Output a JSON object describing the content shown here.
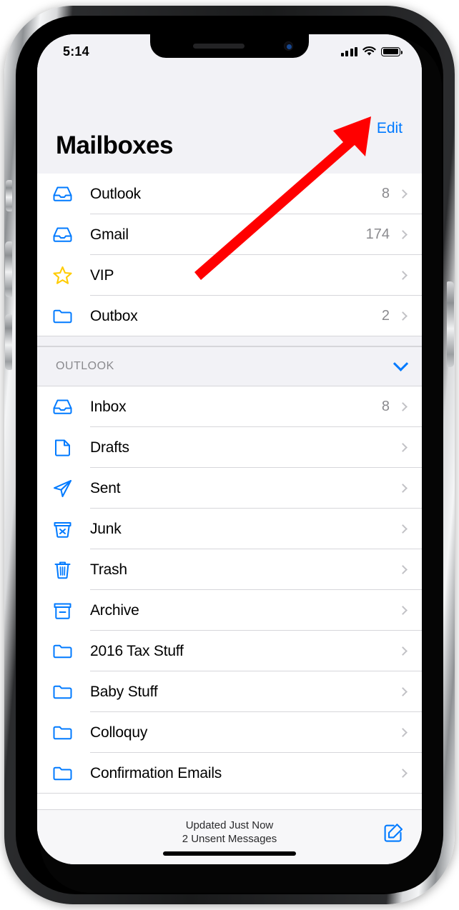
{
  "status_bar": {
    "time": "5:14",
    "signal_icon": "cellular-signal-icon",
    "wifi_icon": "wifi-icon",
    "battery_icon": "battery-icon"
  },
  "navbar": {
    "title": "Mailboxes",
    "edit_label": "Edit"
  },
  "colors": {
    "accent_blue": "#007AFF",
    "star_yellow": "#FFCC00",
    "annotation_red": "#FF0000",
    "header_bg": "#F2F2F6",
    "separator": "#D6D6DA",
    "count_gray": "#8A8A8E"
  },
  "favorites": [
    {
      "label": "Outlook",
      "count": "8",
      "icon": "inbox-tray-icon"
    },
    {
      "label": "Gmail",
      "count": "174",
      "icon": "inbox-tray-icon"
    },
    {
      "label": "VIP",
      "count": "",
      "icon": "star-icon"
    },
    {
      "label": "Outbox",
      "count": "2",
      "icon": "folder-icon"
    }
  ],
  "section": {
    "title": "OUTLOOK",
    "collapse_icon": "chevron-down-icon"
  },
  "account_mailboxes": [
    {
      "label": "Inbox",
      "count": "8",
      "icon": "inbox-tray-icon"
    },
    {
      "label": "Drafts",
      "count": "",
      "icon": "document-icon"
    },
    {
      "label": "Sent",
      "count": "",
      "icon": "paper-plane-icon"
    },
    {
      "label": "Junk",
      "count": "",
      "icon": "junk-box-icon"
    },
    {
      "label": "Trash",
      "count": "",
      "icon": "trash-icon"
    },
    {
      "label": "Archive",
      "count": "",
      "icon": "archive-box-icon"
    },
    {
      "label": "2016 Tax Stuff",
      "count": "",
      "icon": "folder-icon"
    },
    {
      "label": "Baby Stuff",
      "count": "",
      "icon": "folder-icon"
    },
    {
      "label": "Colloquy",
      "count": "",
      "icon": "folder-icon"
    },
    {
      "label": "Confirmation Emails",
      "count": "",
      "icon": "folder-icon"
    }
  ],
  "toolbar": {
    "updated_text": "Updated Just Now",
    "unsent_text": "2 Unsent Messages",
    "compose_icon": "compose-icon"
  },
  "annotation": {
    "arrow_icon": "red-arrow-pointing-to-edit"
  }
}
